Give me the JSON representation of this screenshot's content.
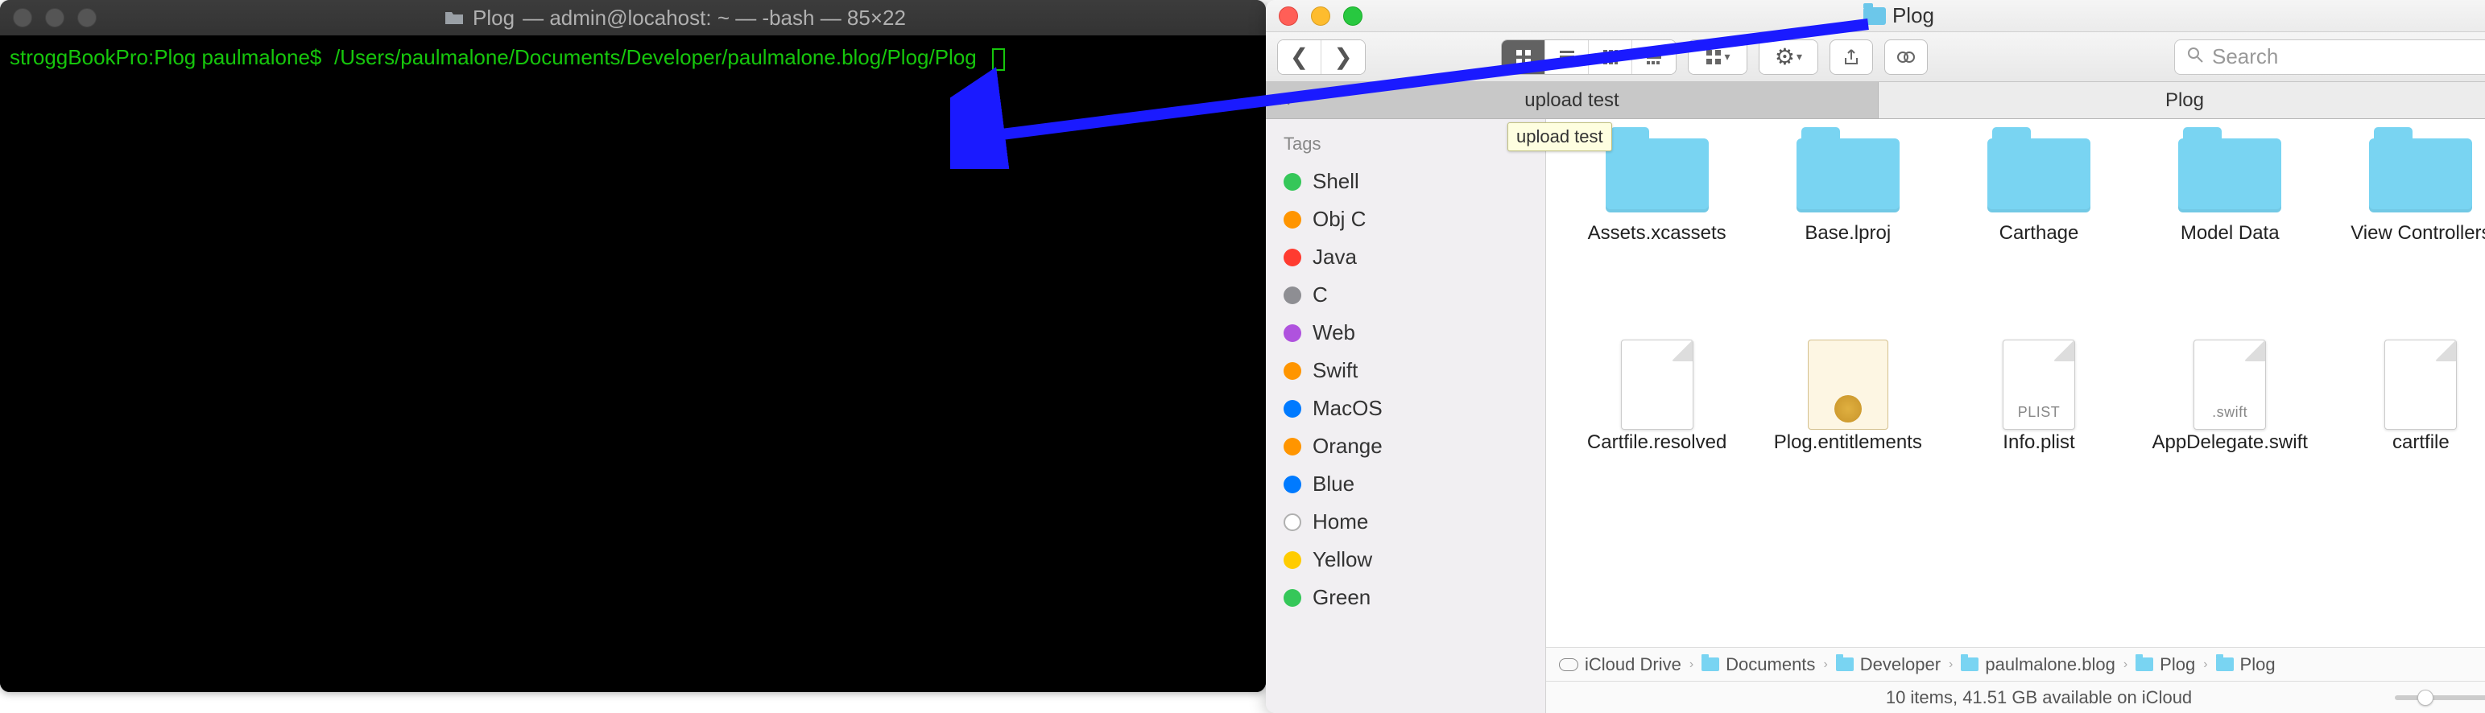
{
  "terminal": {
    "title_folder": "Plog",
    "title_rest": "— admin@locahost: ~ — -bash — 85×22",
    "prompt": "stroggBookPro:Plog paulmalone$",
    "command": "/Users/paulmalone/Documents/Developer/paulmalone.blog/Plog/Plog"
  },
  "finder": {
    "title": "Plog",
    "search_placeholder": "Search",
    "tabs": [
      {
        "label": "upload test",
        "active": false
      },
      {
        "label": "Plog",
        "active": true
      }
    ],
    "tooltip": "upload test",
    "sidebar": {
      "header": "Tags",
      "tags": [
        {
          "label": "Shell",
          "color": "dot-green"
        },
        {
          "label": "Obj C",
          "color": "dot-orange"
        },
        {
          "label": "Java",
          "color": "dot-red"
        },
        {
          "label": "C",
          "color": "dot-gray"
        },
        {
          "label": "Web",
          "color": "dot-purple"
        },
        {
          "label": "Swift",
          "color": "dot-orange"
        },
        {
          "label": "MacOS",
          "color": "dot-blue"
        },
        {
          "label": "Orange",
          "color": "dot-orange"
        },
        {
          "label": "Blue",
          "color": "dot-blue"
        },
        {
          "label": "Home",
          "color": "dot-outline"
        },
        {
          "label": "Yellow",
          "color": "dot-yellow"
        },
        {
          "label": "Green",
          "color": "dot-green"
        }
      ]
    },
    "items": [
      {
        "name": "Assets.xcassets",
        "type": "folder"
      },
      {
        "name": "Base.lproj",
        "type": "folder"
      },
      {
        "name": "Carthage",
        "type": "folder"
      },
      {
        "name": "Model Data",
        "type": "folder"
      },
      {
        "name": "View Controllers",
        "type": "folder"
      },
      {
        "name": "Cartfile.resolved",
        "type": "doc",
        "badge": ""
      },
      {
        "name": "Plog.entitlements",
        "type": "cert"
      },
      {
        "name": "Info.plist",
        "type": "doc",
        "badge": "PLIST"
      },
      {
        "name": "AppDelegate.swift",
        "type": "doc",
        "badge": ".swift"
      },
      {
        "name": "cartfile",
        "type": "doc",
        "badge": ""
      }
    ],
    "path": [
      "iCloud Drive",
      "Documents",
      "Developer",
      "paulmalone.blog",
      "Plog",
      "Plog"
    ],
    "status": "10 items, 41.51 GB available on iCloud"
  }
}
